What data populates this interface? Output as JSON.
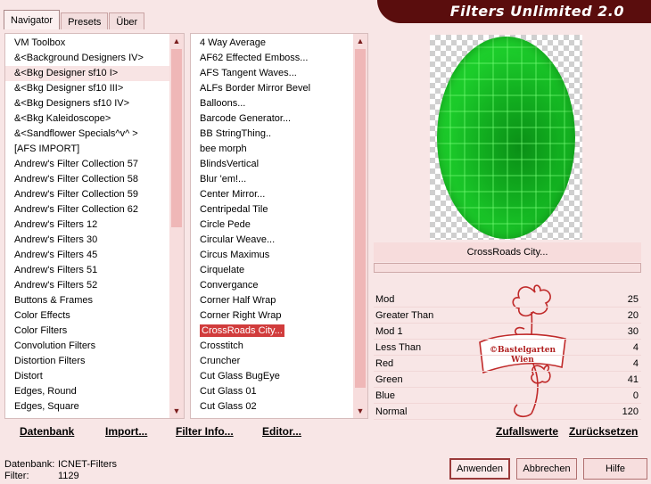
{
  "window": {
    "title": "Filters Unlimited 2.0",
    "tabs": [
      "Navigator",
      "Presets",
      "Über"
    ]
  },
  "categories": {
    "items": [
      "VM Toolbox",
      "&<Background Designers IV>",
      "&<Bkg Designer sf10 I>",
      "&<Bkg Designer sf10 III>",
      "&<Bkg Designers sf10 IV>",
      "&<Bkg Kaleidoscope>",
      "&<Sandflower Specials^v^ >",
      "[AFS IMPORT]",
      "Andrew's Filter Collection 57",
      "Andrew's Filter Collection 58",
      "Andrew's Filter Collection 59",
      "Andrew's Filter Collection 62",
      "Andrew's Filters 12",
      "Andrew's Filters 30",
      "Andrew's Filters 45",
      "Andrew's Filters 51",
      "Andrew's Filters 52",
      "Buttons & Frames",
      "Color Effects",
      "Color Filters",
      "Convolution Filters",
      "Distortion Filters",
      "Distort",
      "Edges, Round",
      "Edges, Square"
    ],
    "selected_index": 2
  },
  "filters": {
    "items": [
      "4 Way Average",
      "AF62 Effected Emboss...",
      "AFS Tangent Waves...",
      "ALFs Border Mirror Bevel",
      "Balloons...",
      "Barcode Generator...",
      "BB StringThing..",
      "bee morph",
      "BlindsVertical",
      "Blur 'em!...",
      "Center Mirror...",
      "Centripedal Tile",
      "Circle Pede",
      "Circular Weave...",
      "Circus Maximus",
      "Cirquelate",
      "Convergance",
      "Corner Half Wrap",
      "Corner Right Wrap",
      "CrossRoads City...",
      "Crosstitch",
      "Cruncher",
      "Cut Glass  BugEye",
      "Cut Glass 01",
      "Cut Glass 02"
    ],
    "selected_index": 19
  },
  "preview": {
    "filter_name": "CrossRoads City..."
  },
  "params": [
    {
      "label": "Mod",
      "value": "25"
    },
    {
      "label": "Greater Than",
      "value": "20"
    },
    {
      "label": "Mod 1",
      "value": "30"
    },
    {
      "label": "Less Than",
      "value": "4"
    },
    {
      "label": "Red",
      "value": "4"
    },
    {
      "label": "Green",
      "value": "41"
    },
    {
      "label": "Blue",
      "value": "0"
    },
    {
      "label": "Normal",
      "value": "120"
    }
  ],
  "watermark": {
    "line1": "©Bastelgarten",
    "line2": "Wien"
  },
  "links": {
    "database": "Datenbank",
    "import": "Import...",
    "filter_info": "Filter Info...",
    "editor": "Editor...",
    "random": "Zufallswerte",
    "reset": "Zurücksetzen"
  },
  "status": {
    "db_label": "Datenbank:",
    "db_value": "ICNET-Filters",
    "filter_label": "Filter:",
    "filter_value": "1129"
  },
  "buttons": {
    "apply": "Anwenden",
    "cancel": "Abbrechen",
    "help": "Hilfe"
  },
  "colors": {
    "accent": "#d13c3c",
    "banner": "#5a0d0d",
    "background": "#f8e6e6"
  }
}
